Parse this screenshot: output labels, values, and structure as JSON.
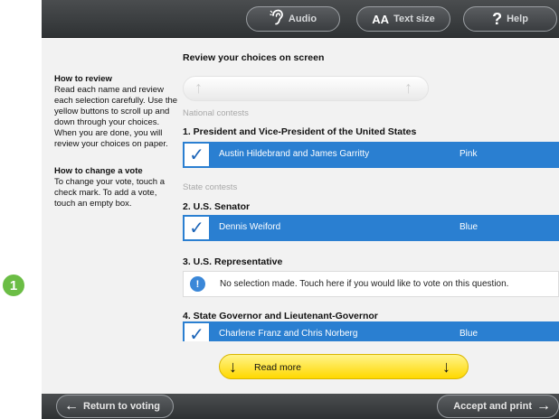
{
  "step_marker": "1",
  "topbar": {
    "audio_label": "Audio",
    "audio_icon": "ear-icon",
    "text_size_label": "Text size",
    "text_size_icon": "AA",
    "help_label": "Help",
    "help_icon": "?"
  },
  "instructions": {
    "review_heading": "How to review",
    "review_text": "Read each name and review each selection carefully. Use the yellow buttons to scroll up and down through your choices. When you are done, you will review your choices on paper.",
    "change_heading": "How to change a vote",
    "change_text": "To change your vote, touch a check mark. To add a vote, touch an empty box."
  },
  "main": {
    "title": "Review your choices on screen",
    "national_label": "National contests",
    "state_label": "State contests",
    "contests": [
      {
        "title": "1. President and Vice-President of the United States",
        "selection": "Austin Hildebrand and James Garritty",
        "party": "Pink"
      },
      {
        "title": "2. U.S. Senator",
        "selection": "Dennis Weiford",
        "party": "Blue"
      },
      {
        "title": "3. U.S. Representative",
        "no_selection_text": "No selection made. Touch here if you would like to vote on this question."
      },
      {
        "title": "4. State Governor and Lieutenant-Governor",
        "selection": "Charlene Franz and Chris Norberg",
        "party": "Blue"
      }
    ],
    "read_more_label": "Read more"
  },
  "bottombar": {
    "return_label": "Return to voting",
    "accept_label": "Accept and print"
  },
  "colors": {
    "selection_blue": "#2a7fd1",
    "read_more_yellow": "#ffd800",
    "step_green": "#6bbd45",
    "bar_dark": "#3a3d40"
  }
}
